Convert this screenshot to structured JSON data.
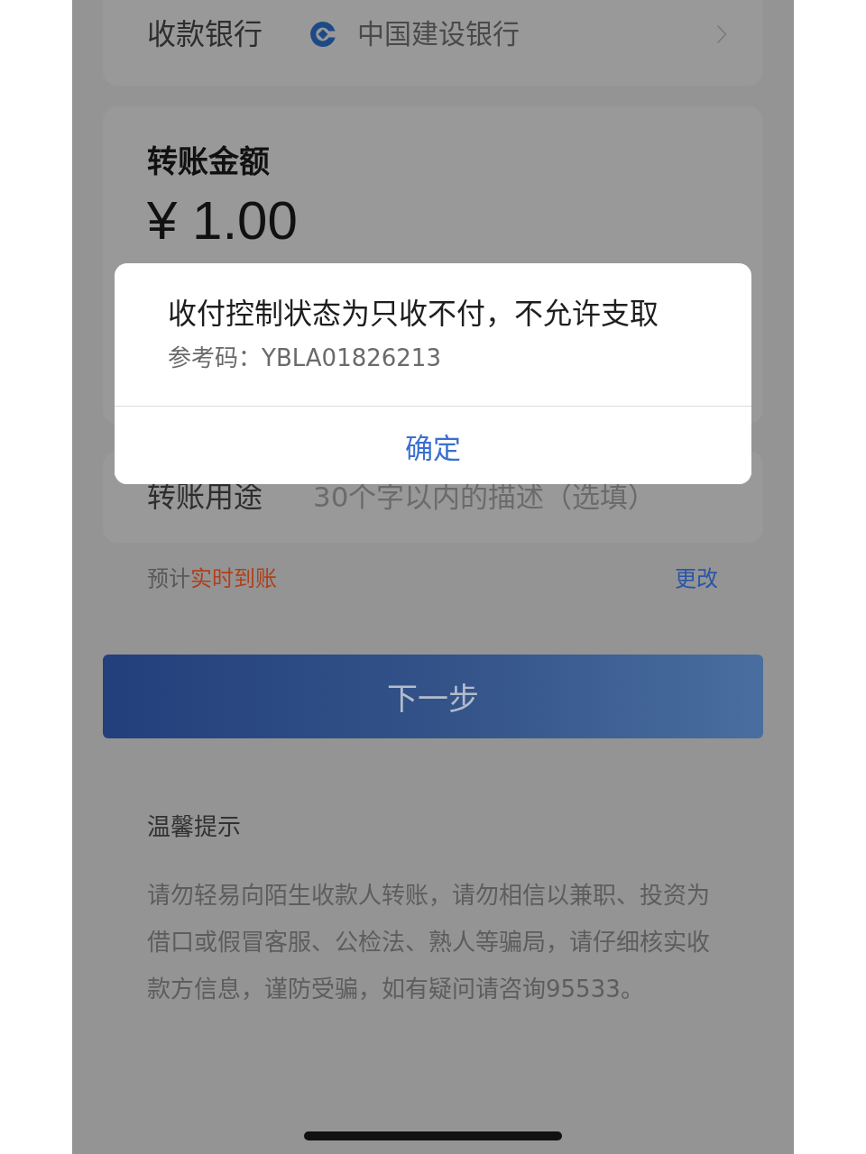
{
  "bank_row": {
    "label": "收款银行",
    "value": "中国建设银行"
  },
  "amount_card": {
    "title": "转账金额",
    "amount": "¥ 1.00"
  },
  "purpose_field": {
    "label": "转账用途",
    "placeholder": "30个字以内的描述（选填）"
  },
  "arrival": {
    "prefix": "预计",
    "highlight": "实时到账",
    "action": "更改"
  },
  "next_button": {
    "label": "下一步"
  },
  "tips": {
    "title": "温馨提示",
    "text": "请勿轻易向陌生收款人转账，请勿相信以兼职、投资为借口或假冒客服、公检法、熟人等骗局，请仔细核实收款方信息，谨防受骗，如有疑问请咨询95533。"
  },
  "dialog": {
    "message": "收付控制状态为只收不付，不允许支取",
    "reference": "参考码：YBLA01826213",
    "buttons": [
      "确定"
    ]
  }
}
